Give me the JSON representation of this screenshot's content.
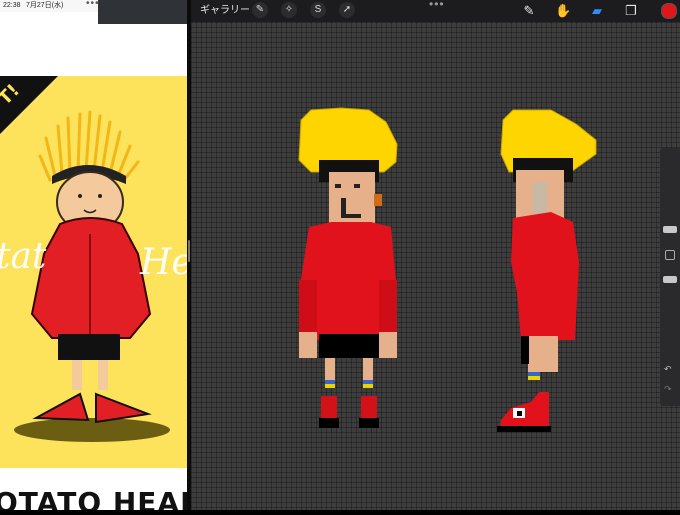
{
  "left_status": {
    "time": "22:38",
    "date": "7月27日(水)"
  },
  "left_art": {
    "banner_text": "T!",
    "tagline_left": "tat",
    "tagline_right": "He",
    "brand_text": "OTATO HEAD"
  },
  "toolbar": {
    "gallery_label": "ギャラリー",
    "dots": "•••"
  },
  "colors": {
    "primary_color": "#e0161b",
    "canvas_bg": "#3d3d3d",
    "yellow": "#fde25c"
  },
  "icons": {
    "actions": "wrench-icon",
    "adjustments": "magic-wand-icon",
    "selection": "selection-icon",
    "transform": "arrow-icon",
    "brush": "brush-icon",
    "smudge": "smudge-icon",
    "eraser": "eraser-icon",
    "layers": "layers-icon"
  },
  "sidebar": {
    "undo": "↶",
    "redo": "↷"
  }
}
